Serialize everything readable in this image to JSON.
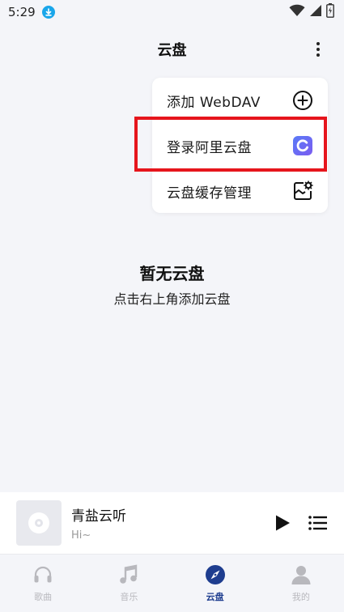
{
  "status_bar": {
    "time": "5:29"
  },
  "header": {
    "title": "云盘"
  },
  "menu": {
    "items": [
      {
        "label": "添加 WebDAV",
        "icon": "plus-circle-icon"
      },
      {
        "label": "登录阿里云盘",
        "icon": "aliyun-drive-icon"
      },
      {
        "label": "云盘缓存管理",
        "icon": "cache-settings-icon"
      }
    ],
    "highlight_color": "#e6151c"
  },
  "empty_state": {
    "title": "暂无云盘",
    "subtitle": "点击右上角添加云盘"
  },
  "player": {
    "title": "青盐云听",
    "subtitle": "Hi~"
  },
  "nav": {
    "items": [
      {
        "label": "歌曲",
        "icon": "headphones-icon",
        "active": false
      },
      {
        "label": "音乐",
        "icon": "music-note-icon",
        "active": false
      },
      {
        "label": "云盘",
        "icon": "compass-icon",
        "active": true
      },
      {
        "label": "我的",
        "icon": "person-icon",
        "active": false
      }
    ],
    "active_color": "#1e3d8f",
    "inactive_color": "#b8b8bd"
  }
}
